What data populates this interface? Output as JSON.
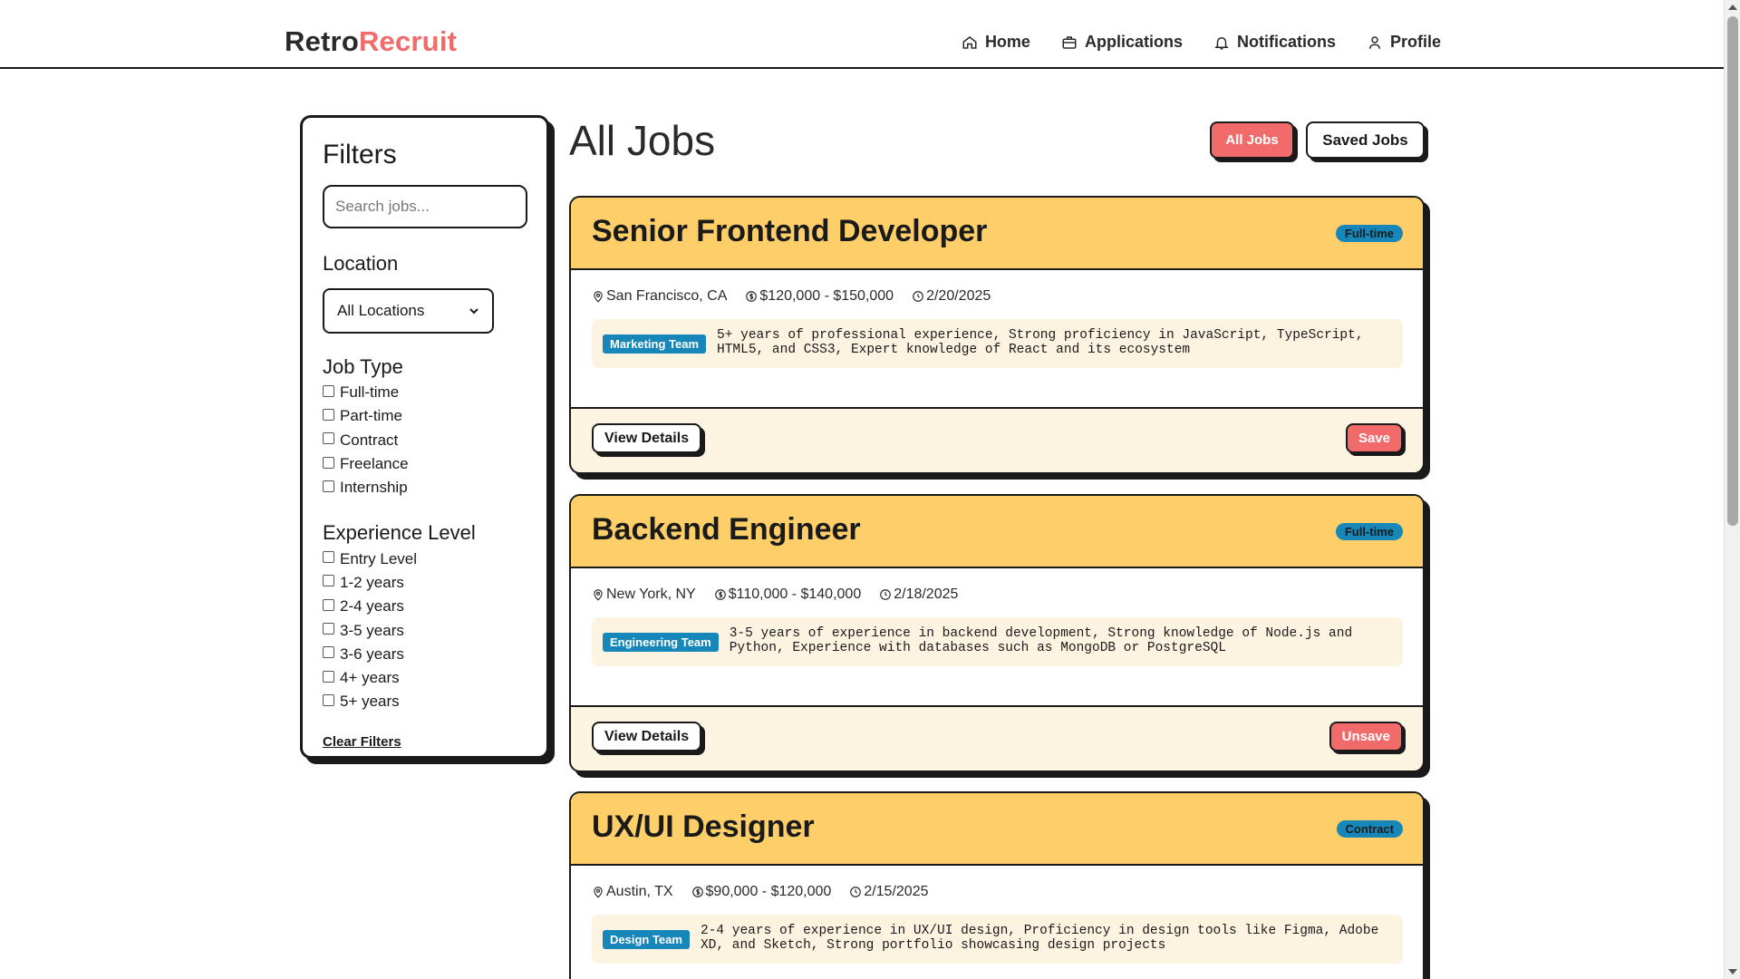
{
  "brand": {
    "part1": "Retro",
    "part2": "Recruit"
  },
  "nav": [
    {
      "label": "Home",
      "icon": "home-icon"
    },
    {
      "label": "Applications",
      "icon": "briefcase-icon"
    },
    {
      "label": "Notifications",
      "icon": "bell-icon"
    },
    {
      "label": "Profile",
      "icon": "user-icon"
    }
  ],
  "filters": {
    "title": "Filters",
    "search_placeholder": "Search jobs...",
    "location_label": "Location",
    "location_value": "All Locations",
    "job_type_label": "Job Type",
    "job_types": [
      "Full-time",
      "Part-time",
      "Contract",
      "Freelance",
      "Internship"
    ],
    "experience_label": "Experience Level",
    "experience_levels": [
      "Entry Level",
      "1-2 years",
      "2-4 years",
      "3-5 years",
      "3-6 years",
      "4+ years",
      "5+ years"
    ],
    "clear_label": "Clear Filters"
  },
  "main": {
    "title": "All Jobs",
    "all_jobs_label": "All Jobs",
    "saved_jobs_label": "Saved Jobs"
  },
  "jobs": [
    {
      "title": "Senior Frontend Developer",
      "type": "Full-time",
      "location": "San Francisco, CA",
      "salary": "$120,000 - $150,000",
      "date": "2/20/2025",
      "team": "Marketing Team",
      "requirements": "5+ years of professional experience, Strong proficiency in JavaScript, TypeScript, HTML5, and CSS3, Expert knowledge of React and its ecosystem",
      "view_label": "View Details",
      "save_label": "Save"
    },
    {
      "title": "Backend Engineer",
      "type": "Full-time",
      "location": "New York, NY",
      "salary": "$110,000 - $140,000",
      "date": "2/18/2025",
      "team": "Engineering Team",
      "requirements": "3-5 years of experience in backend development, Strong knowledge of Node.js and Python, Experience with databases such as MongoDB or PostgreSQL",
      "view_label": "View Details",
      "save_label": "Unsave"
    },
    {
      "title": "UX/UI Designer",
      "type": "Contract",
      "location": "Austin, TX",
      "salary": "$90,000 - $120,000",
      "date": "2/15/2025",
      "team": "Design Team",
      "requirements": "2-4 years of experience in UX/UI design, Proficiency in design tools like Figma, Adobe XD, and Sketch, Strong portfolio showcasing design projects"
    }
  ],
  "colors": {
    "accent": "#f26b6b",
    "card_header": "#fecf68",
    "badge": "#1687b8",
    "card_bg": "#fdf3e1"
  }
}
